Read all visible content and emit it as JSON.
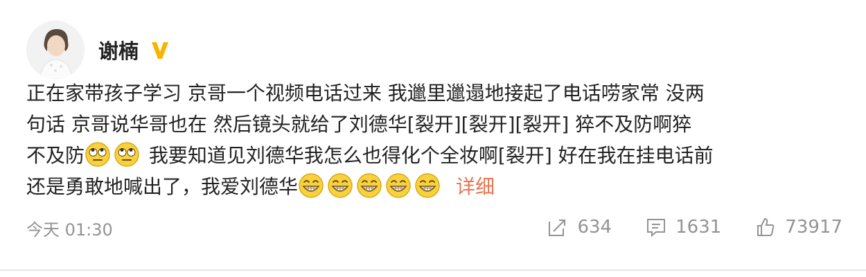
{
  "post": {
    "author": {
      "name": "谢楠",
      "verified_badge_icon": "verified-v-icon",
      "avatar_icon": "avatar"
    },
    "body": {
      "line1": "正在家带孩子学习 京哥一个视频电话过来 我邋里邋遢地接起了电话唠家常 没两",
      "line2": "句话 京哥说华哥也在 然后镜头就给了刘德华[裂开][裂开][裂开] 猝不及防啊猝",
      "line3_pre": "不及防",
      "line3_post": " 我要知道见刘德华我怎么也得化个全妆啊[裂开] 好在我在挂电话前",
      "line4_pre": "还是勇敢地喊出了，我爱刘德华",
      "more": "详细"
    },
    "emojis": {
      "line3": [
        "rolling-eyes-emoji",
        "rolling-eyes-emoji"
      ],
      "line4": [
        "grin-emoji",
        "grin-emoji",
        "grin-emoji",
        "grin-emoji",
        "grin-emoji"
      ]
    },
    "time": "今天 01:30",
    "stats": {
      "reposts": "634",
      "comments": "1631",
      "likes": "73917"
    }
  },
  "colors": {
    "link": "#eb7350",
    "meta": "#939393",
    "badge": "#f6b500"
  }
}
